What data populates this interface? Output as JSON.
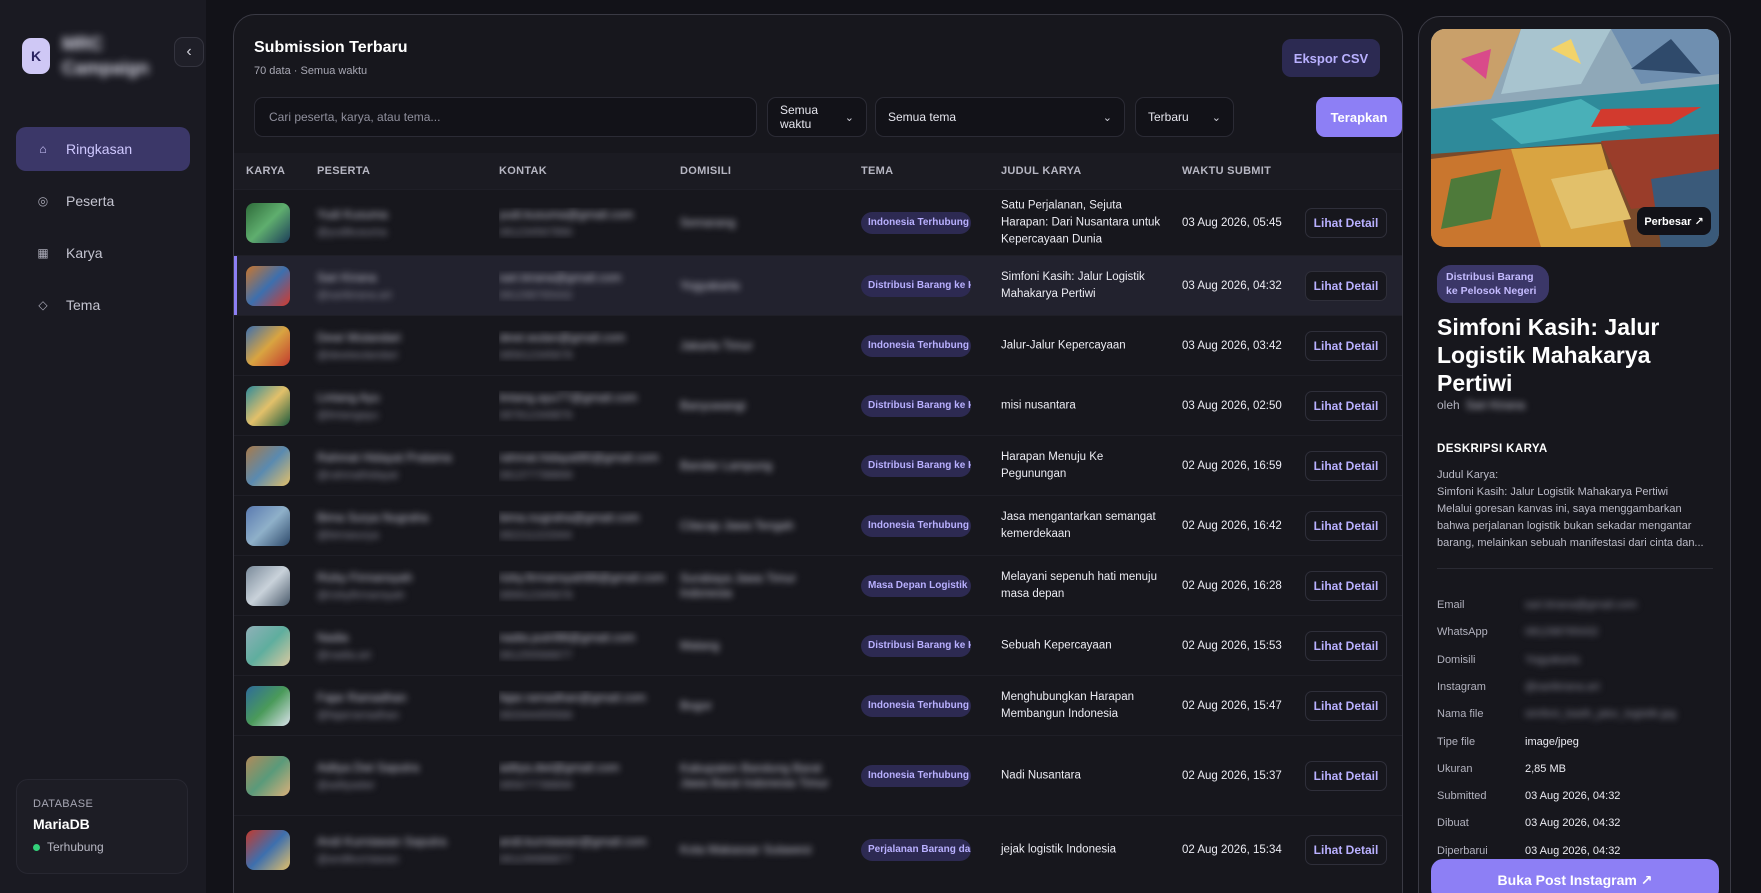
{
  "brand": {
    "logo": "K",
    "line1": "MRC",
    "line2": "Campaign"
  },
  "sidebar": {
    "items": [
      {
        "label": "Ringkasan",
        "icon": "home-icon"
      },
      {
        "label": "Peserta",
        "icon": "user-icon"
      },
      {
        "label": "Karya",
        "icon": "grid-icon"
      },
      {
        "label": "Tema",
        "icon": "diamond-icon"
      }
    ],
    "database": {
      "label": "DATABASE",
      "name": "MariaDB",
      "status": "Terhubung",
      "status_color": "#33d17a"
    }
  },
  "main": {
    "title": "Submission Terbaru",
    "subtitle": "70 data · Semua waktu",
    "export_label": "Ekspor CSV",
    "search_placeholder": "Cari peserta, karya, atau tema...",
    "filter_time": "Semua waktu",
    "filter_theme": "Semua tema",
    "filter_sort": "Terbaru",
    "apply_label": "Terapkan",
    "columns": [
      "KARYA",
      "PESERTA",
      "KONTAK",
      "DOMISILI",
      "TEMA",
      "JUDUL KARYA",
      "WAKTU SUBMIT"
    ],
    "detail_label": "Lihat Detail",
    "rows": [
      {
        "name": "Yudi Kusuma",
        "sub": "@yudikusuma",
        "contact": "yudi.kusuma@gmail.com",
        "phone": "081234567890",
        "city": "Semarang",
        "tema": "Indonesia Terhubung",
        "judul": "Satu Perjalanan, Sejuta Harapan: Dari Nusantara untuk Kepercayaan Dunia",
        "waktu": "03 Aug 2026, 05:45"
      },
      {
        "name": "Sari Kirana",
        "sub": "@sarikirana.art",
        "contact": "sari.kirana@gmail.com",
        "phone": "081298765432",
        "city": "Yogyakarta",
        "tema": "Distribusi Barang ke Pelosok Negeri",
        "judul": "Simfoni Kasih: Jalur Logistik Mahakarya Pertiwi",
        "waktu": "03 Aug 2026, 04:32"
      },
      {
        "name": "Dewi Wulandari",
        "sub": "@dewiwulandari",
        "contact": "dewi.wulan@gmail.com",
        "phone": "085612345678",
        "city": "Jakarta Timur",
        "tema": "Indonesia Terhubung",
        "judul": "Jalur-Jalur Kepercayaan",
        "waktu": "03 Aug 2026, 03:42"
      },
      {
        "name": "Lintang Ayu",
        "sub": "@lintangayu",
        "contact": "lintang.ayu77@gmail.com",
        "phone": "087812349876",
        "city": "Banyuwangi",
        "tema": "Distribusi Barang ke Pelosok Negeri",
        "judul": "misi nusantara",
        "waktu": "03 Aug 2026, 02:50"
      },
      {
        "name": "Rahmat Hidayat Pratama",
        "sub": "@rahmathidayat",
        "contact": "rahmat.hidayat90@gmail.com",
        "phone": "081377788899",
        "city": "Bandar Lampung",
        "tema": "Distribusi Barang ke Pelosok Negeri",
        "judul": "Harapan Menuju Ke Pegunungan",
        "waktu": "02 Aug 2026, 16:59"
      },
      {
        "name": "Bima Surya Nugraha",
        "sub": "@bimasurya",
        "contact": "bima.nugraha@gmail.com",
        "phone": "082211223344",
        "city": "Cilacap Jawa Tengah",
        "tema": "Indonesia Terhubung",
        "judul": "Jasa mengantarkan semangat kemerdekaan",
        "waktu": "02 Aug 2026, 16:42"
      },
      {
        "name": "Rizky Firmansyah",
        "sub": "@rizkyfirmansyah",
        "contact": "rizky.firmansyah88@gmail.com",
        "phone": "089912345678",
        "city": "Surabaya Jawa Timur Indonesia",
        "tema": "Masa Depan Logistik",
        "judul": "Melayani sepenuh hati menuju masa depan",
        "waktu": "02 Aug 2026, 16:28"
      },
      {
        "name": "Nadia",
        "sub": "@nadia.art",
        "contact": "nadia.putri98@gmail.com",
        "phone": "081255566677",
        "city": "Malang",
        "tema": "Distribusi Barang ke Pelosok Negeri",
        "judul": "Sebuah Kepercayaan",
        "waktu": "02 Aug 2026, 15:53"
      },
      {
        "name": "Fajar Ramadhan",
        "sub": "@fajarramadhan",
        "contact": "fajar.ramadhan@gmail.com",
        "phone": "083344455566",
        "city": "Bogor",
        "tema": "Indonesia Terhubung",
        "judul": "Menghubungkan Harapan Membangun Indonesia",
        "waktu": "02 Aug 2026, 15:47"
      },
      {
        "name": "Aditya Dwi Saputra",
        "sub": "@adityadwi",
        "contact": "aditya.dwi@gmail.com",
        "phone": "085677788899",
        "city": "Kabupaten Bandung Barat Jawa Barat Indonesia Timur",
        "tema": "Indonesia Terhubung",
        "judul": "Nadi Nusantara",
        "waktu": "02 Aug 2026, 15:37"
      },
      {
        "name": "Andi Kurniawan Saputra",
        "sub": "@andikurniawan",
        "contact": "andi.kurniawan@gmail.com",
        "phone": "081199988877",
        "city": "Kota Makassar Sulawesi",
        "tema": "Perjalanan Barang dari Desa ke Kota",
        "judul": "jejak logistik Indonesia",
        "waktu": "02 Aug 2026, 15:34"
      }
    ]
  },
  "detail": {
    "zoom_label": "Perbesar ↗",
    "tag": "Distribusi Barang ke Pelosok Negeri",
    "title": "Simfoni Kasih: Jalur Logistik Mahakarya Pertiwi",
    "by_label": "oleh",
    "by_name": "Sari Kirana",
    "desc_header": "DESKRIPSI KARYA",
    "desc_label": "Judul Karya:",
    "desc_title": "Simfoni Kasih: Jalur Logistik Mahakarya Pertiwi",
    "desc_body": "Melalui goresan kanvas ini, saya menggambarkan bahwa perjalanan logistik bukan sekadar mengantar barang, melainkan sebuah manifestasi dari cinta dan...",
    "meta": [
      {
        "k": "Email",
        "v": "sari.kirana@gmail.com",
        "blur": true
      },
      {
        "k": "WhatsApp",
        "v": "081298765432",
        "blur": true
      },
      {
        "k": "Domisili",
        "v": "Yogyakarta",
        "blur": true
      },
      {
        "k": "Instagram",
        "v": "@sarikirana.art",
        "blur": true
      },
      {
        "k": "Nama file",
        "v": "simfoni_kasih_jalur_logistik.jpg",
        "blur": true
      },
      {
        "k": "Tipe file",
        "v": "image/jpeg",
        "blur": false
      },
      {
        "k": "Ukuran",
        "v": "2,85 MB",
        "blur": false
      },
      {
        "k": "Submitted",
        "v": "03 Aug 2026, 04:32",
        "blur": false
      },
      {
        "k": "Dibuat",
        "v": "03 Aug 2026, 04:32",
        "blur": false
      },
      {
        "k": "Diperbarui",
        "v": "03 Aug 2026, 04:32",
        "blur": false
      }
    ],
    "instagram_label": "Buka Post Instagram ↗"
  },
  "colors": {
    "accent": "#8d7ff5",
    "accent_soft": "#3b3768",
    "tag_bg": "#2d2a52",
    "tag_text": "#b9b0ff"
  }
}
